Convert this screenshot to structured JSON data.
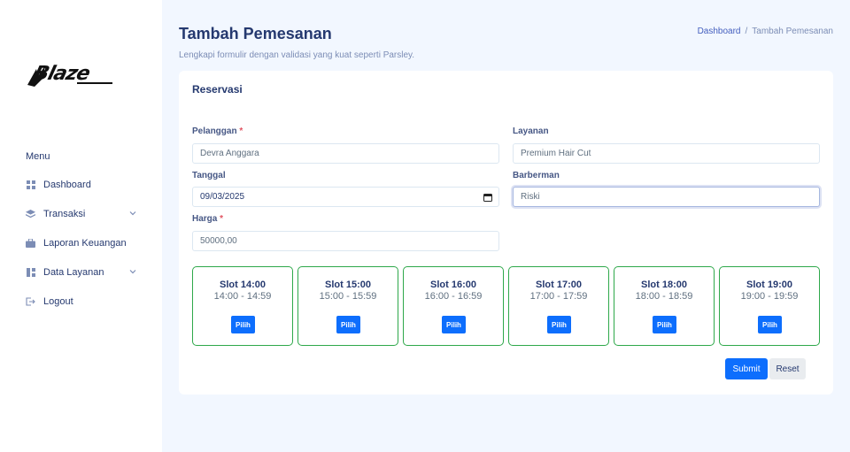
{
  "sidebar": {
    "logo_text": "Blaze",
    "menu_title": "Menu",
    "items": [
      {
        "label": "Dashboard",
        "icon": "grid-icon"
      },
      {
        "label": "Transaksi",
        "icon": "stack-icon",
        "has_submenu": true
      },
      {
        "label": "Laporan Keuangan",
        "icon": "briefcase-icon"
      },
      {
        "label": "Data Layanan",
        "icon": "layout-icon",
        "has_submenu": true
      },
      {
        "label": "Logout",
        "icon": "logout-icon"
      }
    ]
  },
  "header": {
    "title": "Tambah Pemesanan",
    "subtitle": "Lengkapi formulir dengan validasi yang kuat seperti Parsley.",
    "breadcrumb": [
      "Dashboard",
      "Tambah Pemesanan"
    ]
  },
  "form": {
    "title": "Reservasi",
    "pelanggan": {
      "label": "Pelanggan",
      "required": "*",
      "value": "Devra Anggara"
    },
    "layanan": {
      "label": "Layanan",
      "value": "Premium Hair Cut"
    },
    "tanggal": {
      "label": "Tanggal",
      "value": "09/03/2025"
    },
    "barberman": {
      "label": "Barberman",
      "value": "Riski"
    },
    "harga": {
      "label": "Harga",
      "required": "*",
      "value": "50000,00"
    }
  },
  "slots": [
    {
      "title": "Slot 14:00",
      "range": "14:00 - 14:59",
      "button": "Pilih"
    },
    {
      "title": "Slot 15:00",
      "range": "15:00 - 15:59",
      "button": "Pilih"
    },
    {
      "title": "Slot 16:00",
      "range": "16:00 - 16:59",
      "button": "Pilih"
    },
    {
      "title": "Slot 17:00",
      "range": "17:00 - 17:59",
      "button": "Pilih"
    },
    {
      "title": "Slot 18:00",
      "range": "18:00 - 18:59",
      "button": "Pilih"
    },
    {
      "title": "Slot 19:00",
      "range": "19:00 - 19:59",
      "button": "Pilih"
    }
  ],
  "actions": {
    "submit": "Submit",
    "reset": "Reset"
  },
  "colors": {
    "primary": "#0d6efd",
    "slot_border": "#2ea84a",
    "text": "#25396f",
    "muted": "#7c8db5",
    "background": "#f2f7ff"
  }
}
